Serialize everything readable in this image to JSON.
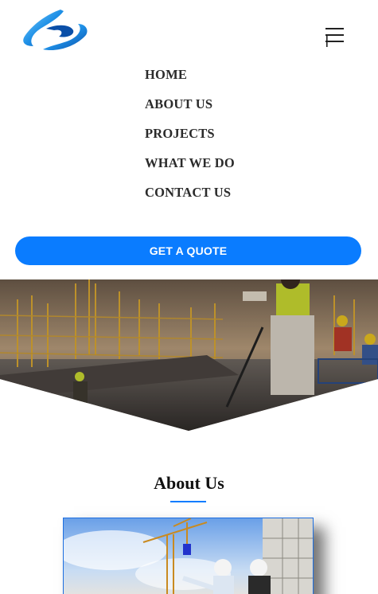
{
  "nav": {
    "items": [
      {
        "label": "HOME"
      },
      {
        "label": "ABOUT US"
      },
      {
        "label": "PROJECTS"
      },
      {
        "label": "WHAT WE DO"
      },
      {
        "label": "CONTACT US"
      }
    ]
  },
  "cta": {
    "label": "GET A QUOTE"
  },
  "about": {
    "title": "About Us"
  },
  "colors": {
    "accent": "#0a7cff",
    "nav_text": "#2b2b2b"
  },
  "icons": {
    "logo": "company-logo",
    "menu": "hamburger-menu-icon"
  }
}
